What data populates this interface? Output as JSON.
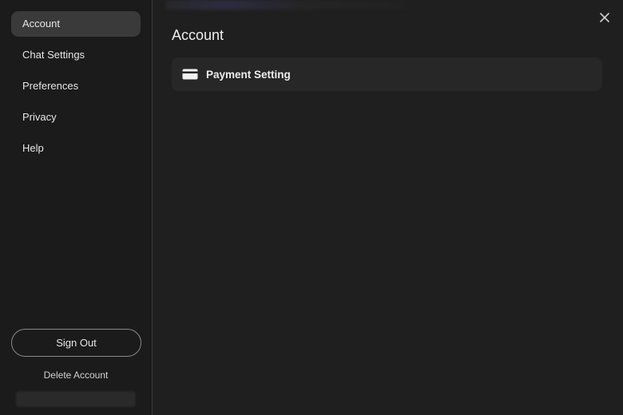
{
  "sidebar": {
    "items": [
      {
        "label": "Account",
        "active": true
      },
      {
        "label": "Chat Settings",
        "active": false
      },
      {
        "label": "Preferences",
        "active": false
      },
      {
        "label": "Privacy",
        "active": false
      },
      {
        "label": "Help",
        "active": false
      }
    ],
    "sign_out_label": "Sign Out",
    "delete_account_label": "Delete Account"
  },
  "main": {
    "title": "Account",
    "settings": [
      {
        "label": "Payment Setting",
        "icon": "credit-card-icon"
      }
    ]
  },
  "icons": {
    "close": "close-icon"
  },
  "colors": {
    "background": "#1f1f1f",
    "sidebar": "#1b1b1b",
    "active_item": "#3a3a3a",
    "row": "#272727"
  }
}
